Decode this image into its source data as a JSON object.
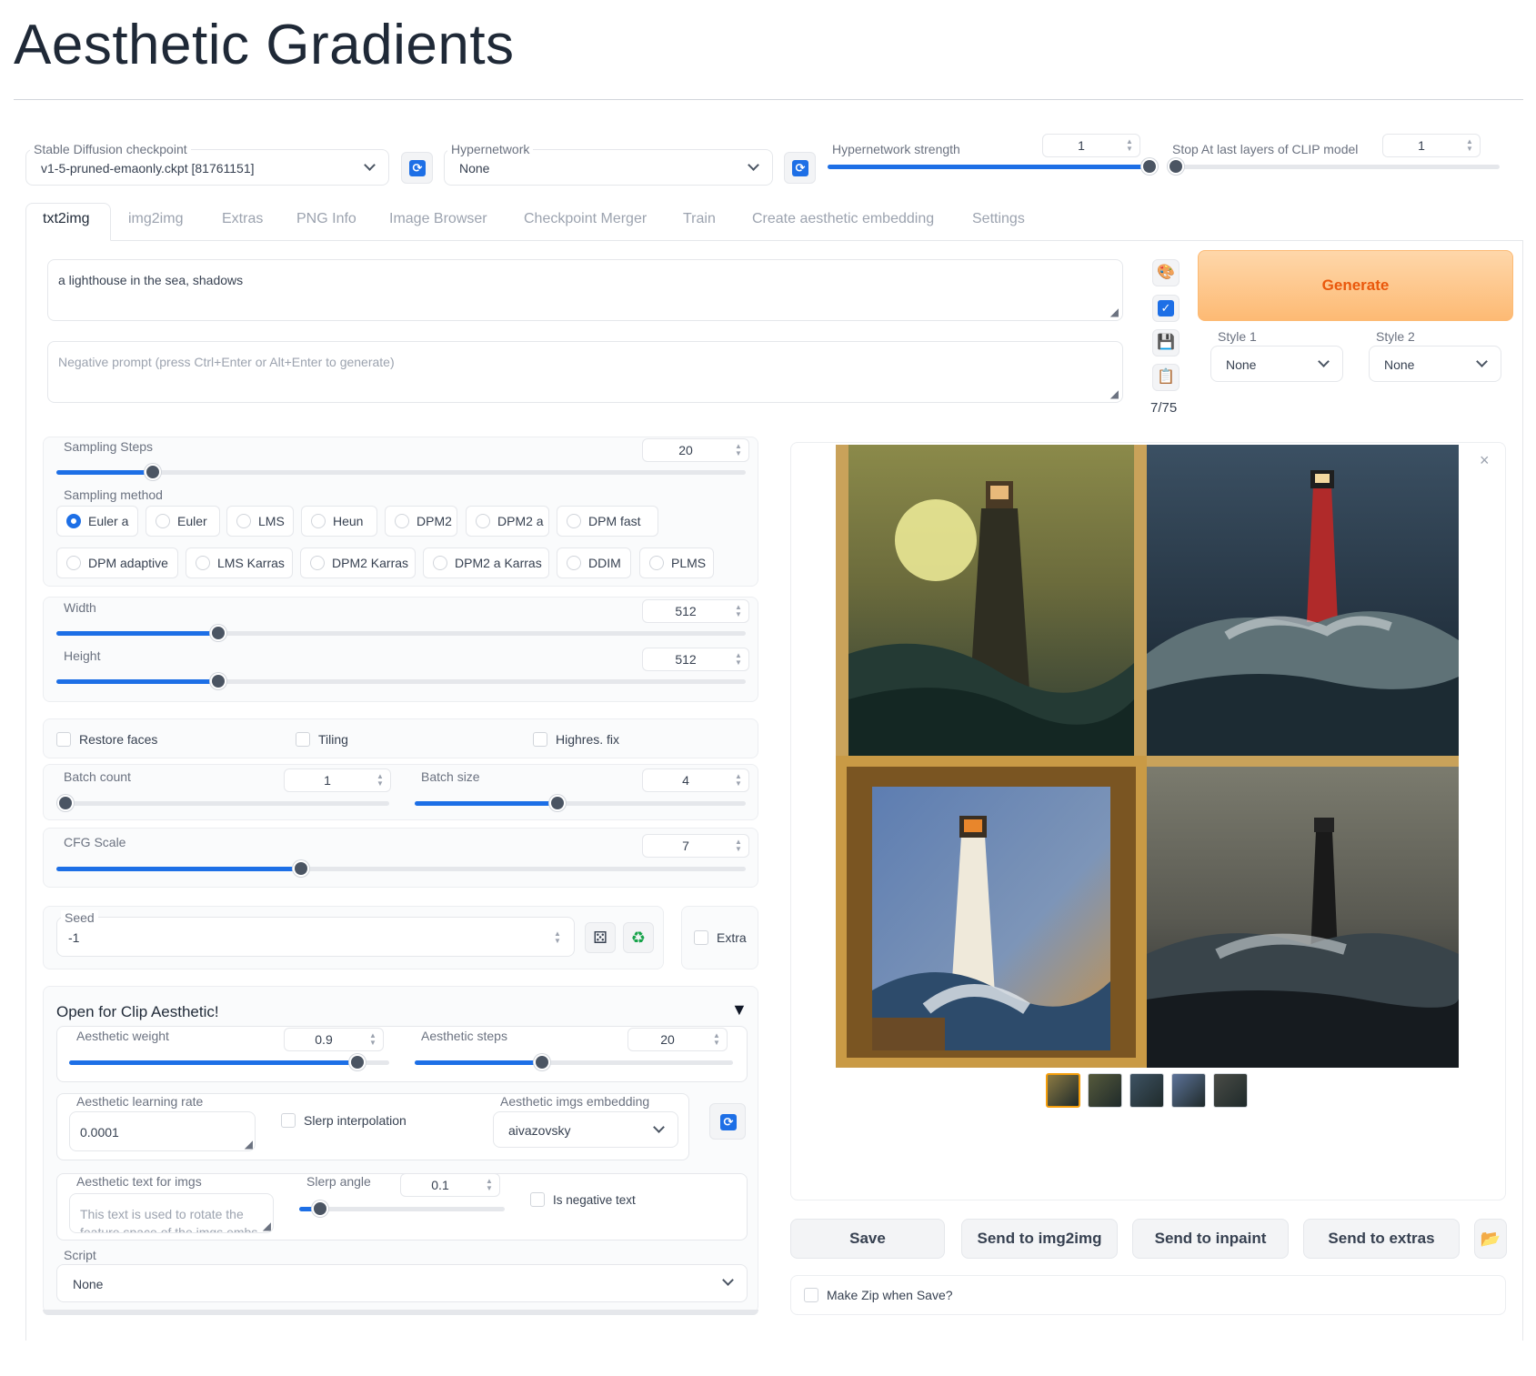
{
  "page": {
    "title": "Aesthetic Gradients"
  },
  "top": {
    "checkpoint_label": "Stable Diffusion checkpoint",
    "checkpoint_value": "v1-5-pruned-emaonly.ckpt [81761151]",
    "hypernetwork_label": "Hypernetwork",
    "hypernetwork_value": "None",
    "hn_strength_label": "Hypernetwork strength",
    "hn_strength_value": "1",
    "hn_strength_fraction": 1.0,
    "clip_label": "Stop At last layers of CLIP model",
    "clip_value": "1",
    "clip_fraction": 0.0
  },
  "tabs": [
    "txt2img",
    "img2img",
    "Extras",
    "PNG Info",
    "Image Browser",
    "Checkpoint Merger",
    "Train",
    "Create aesthetic embedding",
    "Settings"
  ],
  "prompt": {
    "text": "a lighthouse in the sea, shadows",
    "negative_placeholder": "Negative prompt (press Ctrl+Enter or Alt+Enter to generate)",
    "token_count": "7/75"
  },
  "generate": {
    "label": "Generate",
    "style1_label": "Style 1",
    "style1_value": "None",
    "style2_label": "Style 2",
    "style2_value": "None"
  },
  "sampling": {
    "steps_label": "Sampling Steps",
    "steps_value": "20",
    "steps_fraction": 0.14,
    "method_label": "Sampling method",
    "methods_row1": [
      "Euler a",
      "Euler",
      "LMS",
      "Heun",
      "DPM2",
      "DPM2 a",
      "DPM fast"
    ],
    "methods_row2": [
      "DPM adaptive",
      "LMS Karras",
      "DPM2 Karras",
      "DPM2 a Karras",
      "DDIM",
      "PLMS"
    ],
    "selected": "Euler a"
  },
  "size": {
    "width_label": "Width",
    "width_value": "512",
    "width_fraction": 0.235,
    "height_label": "Height",
    "height_value": "512",
    "height_fraction": 0.235
  },
  "options": {
    "restore_faces": "Restore faces",
    "tiling": "Tiling",
    "highres": "Highres. fix"
  },
  "batch": {
    "count_label": "Batch count",
    "count_value": "1",
    "count_fraction": 0.0,
    "size_label": "Batch size",
    "size_value": "4",
    "size_fraction": 0.43
  },
  "cfg": {
    "label": "CFG Scale",
    "value": "7",
    "fraction": 0.355
  },
  "seed": {
    "label": "Seed",
    "value": "-1",
    "extra_label": "Extra"
  },
  "aesthetic": {
    "header": "Open for Clip Aesthetic!",
    "weight_label": "Aesthetic weight",
    "weight_value": "0.9",
    "weight_fraction": 0.9,
    "steps_label": "Aesthetic steps",
    "steps_value": "20",
    "steps_fraction": 0.4,
    "lr_label": "Aesthetic learning rate",
    "lr_value": "0.0001",
    "slerp_interp_label": "Slerp interpolation",
    "embedding_label": "Aesthetic imgs embedding",
    "embedding_value": "aivazovsky",
    "text_label": "Aesthetic text for imgs",
    "text_placeholder": "This text is used to rotate the feature space of the imgs embs",
    "slerp_angle_label": "Slerp angle",
    "slerp_angle_value": "0.1",
    "slerp_angle_fraction": 0.1,
    "negative_label": "Is negative text"
  },
  "script": {
    "label": "Script",
    "value": "None"
  },
  "output": {
    "buttons": [
      "Save",
      "Send to img2img",
      "Send to inpaint",
      "Send to extras"
    ],
    "zip_label": "Make Zip when Save?"
  },
  "colors": {
    "accent": "#1d6fe6",
    "generate_bg": "#fdba74",
    "generate_text": "#ea580c"
  }
}
